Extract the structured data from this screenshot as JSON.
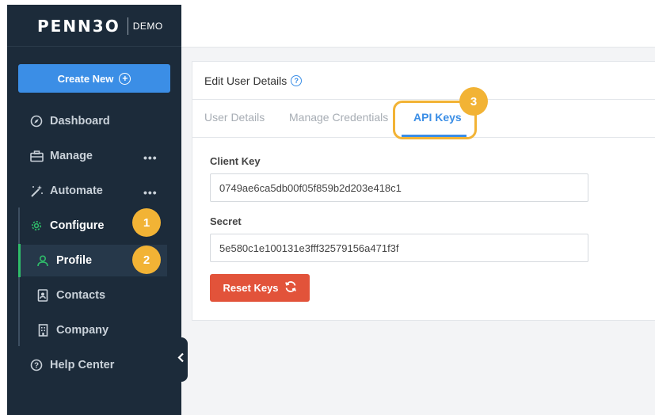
{
  "sidebar": {
    "logo": "PENN3O",
    "logo_tag": "DEMO",
    "create_label": "Create New",
    "items": {
      "dashboard": "Dashboard",
      "manage": "Manage",
      "automate": "Automate",
      "configure": "Configure",
      "profile": "Profile",
      "contacts": "Contacts",
      "company": "Company",
      "help": "Help Center"
    },
    "more_glyph": "•••"
  },
  "badges": {
    "one": "1",
    "two": "2",
    "three": "3"
  },
  "card": {
    "title": "Edit User Details",
    "help_glyph": "?",
    "tabs": [
      "User Details",
      "Manage Credentials",
      "API Keys"
    ],
    "client_key_label": "Client Key",
    "client_key_value": "0749ae6ca5db00f05f859b2d203e418c1",
    "secret_label": "Secret",
    "secret_value": "5e580c1e100131e3fff32579156a471f3f",
    "reset_label": "Reset Keys"
  },
  "colors": {
    "sidebar_bg": "#1c2b3a",
    "accent_blue": "#3b8ee6",
    "active_green": "#2fbd6a",
    "badge_orange": "#f2b335",
    "reset_red": "#e2533a"
  }
}
